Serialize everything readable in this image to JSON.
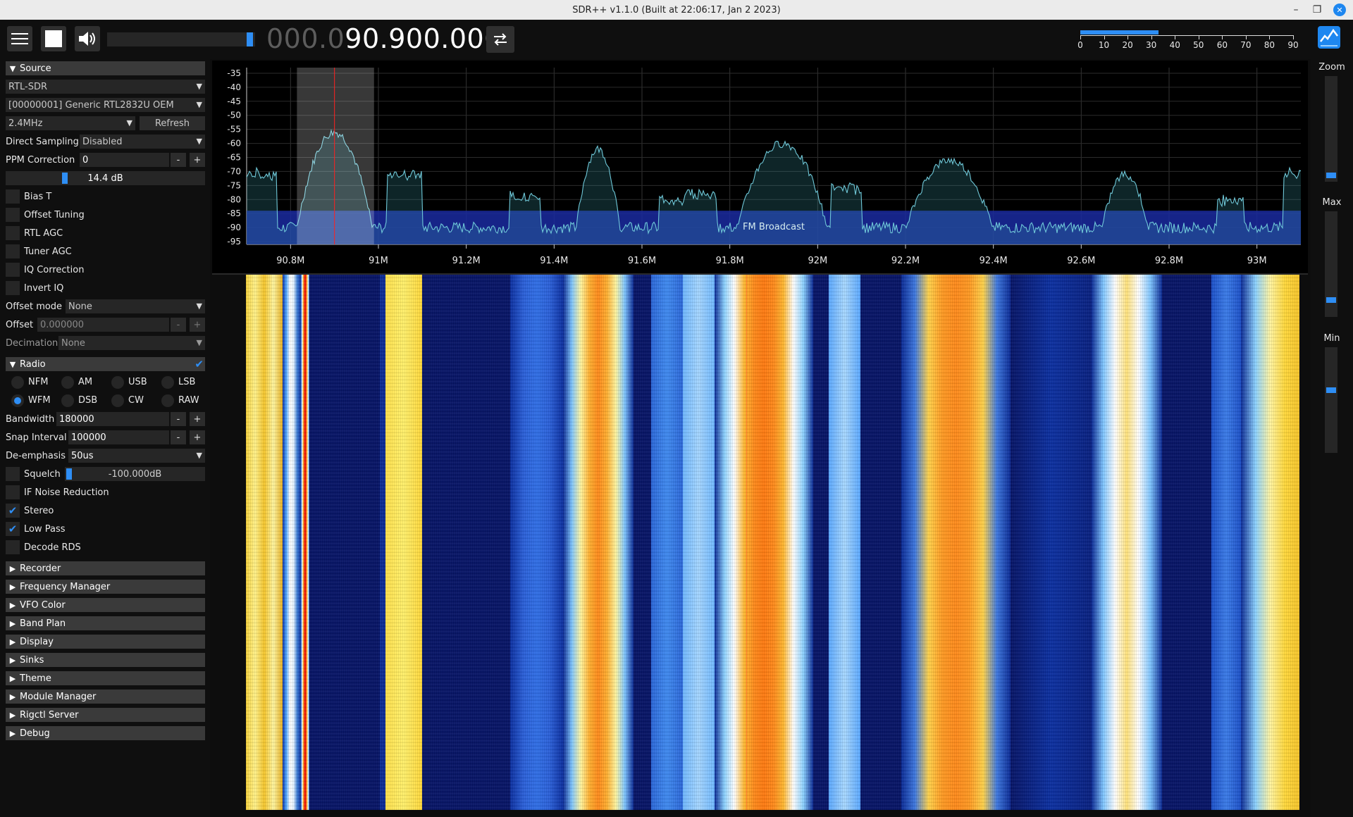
{
  "window": {
    "title": "SDR++ v1.1.0 (Built at 22:06:17, Jan  2 2023)"
  },
  "toolbar": {
    "menu_icon": "hamburger-icon",
    "stop_icon": "stop-icon",
    "volume_icon": "speaker-icon",
    "volume_level": 0.95,
    "freq_dim": "000.0",
    "freq_bright": "90.900.000",
    "tuning_mode_icon": "swap-arrows-icon"
  },
  "snr_meter": {
    "ticks": [
      "0",
      "10",
      "20",
      "30",
      "40",
      "50",
      "60",
      "70",
      "80",
      "90"
    ],
    "level": 33
  },
  "source": {
    "header": "Source",
    "device": "RTL-SDR",
    "usb_device": "[00000001] Generic RTL2832U OEM",
    "sample_rate": "2.4MHz",
    "refresh_label": "Refresh",
    "direct_sampling_label": "Direct Sampling",
    "direct_sampling_value": "Disabled",
    "ppm_label": "PPM Correction",
    "ppm_value": "0",
    "gain_value": "14.4 dB",
    "gain_level": 0.3,
    "checkboxes": [
      {
        "label": "Bias T",
        "checked": false
      },
      {
        "label": "Offset Tuning",
        "checked": false
      },
      {
        "label": "RTL AGC",
        "checked": false
      },
      {
        "label": "Tuner AGC",
        "checked": false
      },
      {
        "label": "IQ Correction",
        "checked": false
      },
      {
        "label": "Invert IQ",
        "checked": false
      }
    ],
    "offset_mode_label": "Offset mode",
    "offset_mode_value": "None",
    "offset_label": "Offset",
    "offset_value": "0.000000",
    "decimation_label": "Decimation",
    "decimation_value": "None"
  },
  "radio": {
    "header": "Radio",
    "modes": [
      "NFM",
      "AM",
      "USB",
      "LSB",
      "WFM",
      "DSB",
      "CW",
      "RAW"
    ],
    "selected_mode": "WFM",
    "bandwidth_label": "Bandwidth",
    "bandwidth_value": "180000",
    "snap_label": "Snap Interval",
    "snap_value": "100000",
    "deemph_label": "De-emphasis",
    "deemph_value": "50us",
    "squelch_label": "Squelch",
    "squelch_value": "-100.000dB",
    "checkboxes": [
      {
        "label": "IF Noise Reduction",
        "checked": false
      },
      {
        "label": "Stereo",
        "checked": true
      },
      {
        "label": "Low Pass",
        "checked": true
      },
      {
        "label": "Decode RDS",
        "checked": false
      }
    ]
  },
  "modules": [
    "Recorder",
    "Frequency Manager",
    "VFO Color",
    "Band Plan",
    "Display",
    "Sinks",
    "Theme",
    "Module Manager",
    "Rigctl Server",
    "Debug"
  ],
  "spectrum": {
    "y_ticks": [
      "-35",
      "-40",
      "-45",
      "-50",
      "-55",
      "-60",
      "-65",
      "-70",
      "-75",
      "-80",
      "-85",
      "-90",
      "-95"
    ],
    "x_ticks": [
      "90.8M",
      "91M",
      "91.2M",
      "91.4M",
      "91.6M",
      "91.8M",
      "92M",
      "92.2M",
      "92.4M",
      "92.6M",
      "92.8M",
      "93M"
    ],
    "band_label": "FM Broadcast",
    "vfo_frequency_mhz": 90.9,
    "vfo_bandwidth_khz": 180
  },
  "right_panel": {
    "zoom_label": "Zoom",
    "max_label": "Max",
    "min_label": "Min"
  },
  "colors": {
    "accent": "#2e8ef5",
    "trace": "#6fc8d8"
  }
}
